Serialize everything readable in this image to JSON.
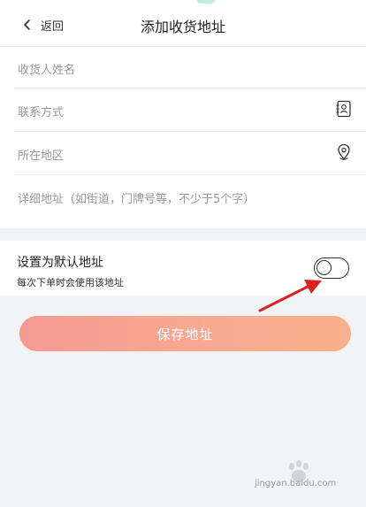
{
  "topbar": {
    "back_label": "返回",
    "title": "添加收货地址"
  },
  "form": {
    "name_placeholder": "收货人姓名",
    "phone_placeholder": "联系方式",
    "region_placeholder": "所在地区",
    "detail_placeholder": "详细地址（如街道，门牌号等，不少于5个字）"
  },
  "default_setting": {
    "title": "设置为默认地址",
    "hint": "每次下单时会使用该地址",
    "enabled": false
  },
  "save_button": {
    "label": "保存地址"
  },
  "watermark": {
    "text": "jingyan.baidu.com"
  },
  "colors": {
    "button_start": "#f59a93",
    "button_end": "#f9b08c",
    "annotation_arrow": "#e02020",
    "page_background": "#f2f3f5"
  }
}
